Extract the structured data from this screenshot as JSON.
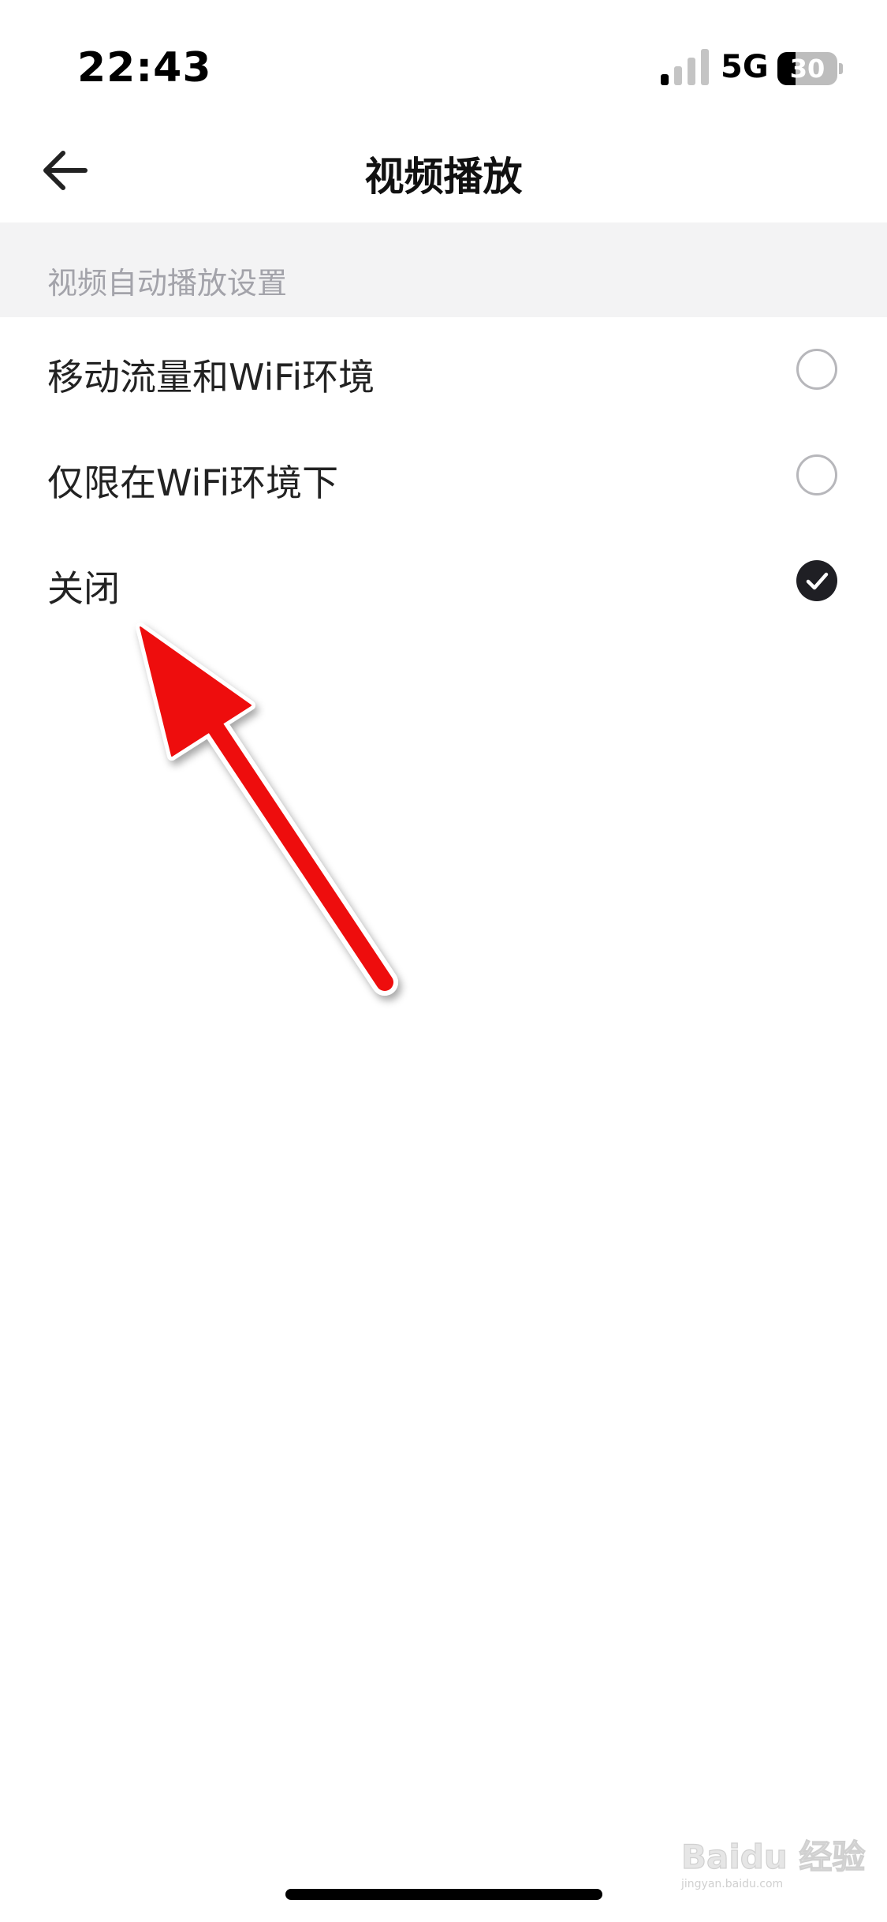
{
  "status_bar": {
    "time": "22:43",
    "network": "5G",
    "battery": {
      "text": "30",
      "level": 0.3
    },
    "signal_bars_active": 1,
    "signal_bars_total": 4
  },
  "nav": {
    "title": "视频播放",
    "back_icon": "arrow-left-icon"
  },
  "section": {
    "header": "视频自动播放设置"
  },
  "options": [
    {
      "label": "移动流量和WiFi环境",
      "selected": false
    },
    {
      "label": "仅限在WiFi环境下",
      "selected": false
    },
    {
      "label": "关闭",
      "selected": true
    }
  ],
  "annotation": {
    "color": "#ee1111",
    "icon": "red-arrow-annotation"
  },
  "watermark": {
    "brand": "Baidu 经验",
    "url": "jingyan.baidu.com"
  },
  "colors": {
    "selected_radio": "#1f1f24",
    "unselected_radio_border": "#b7b7bb",
    "section_bg": "#f3f3f4",
    "section_text": "#a3a3aa"
  }
}
